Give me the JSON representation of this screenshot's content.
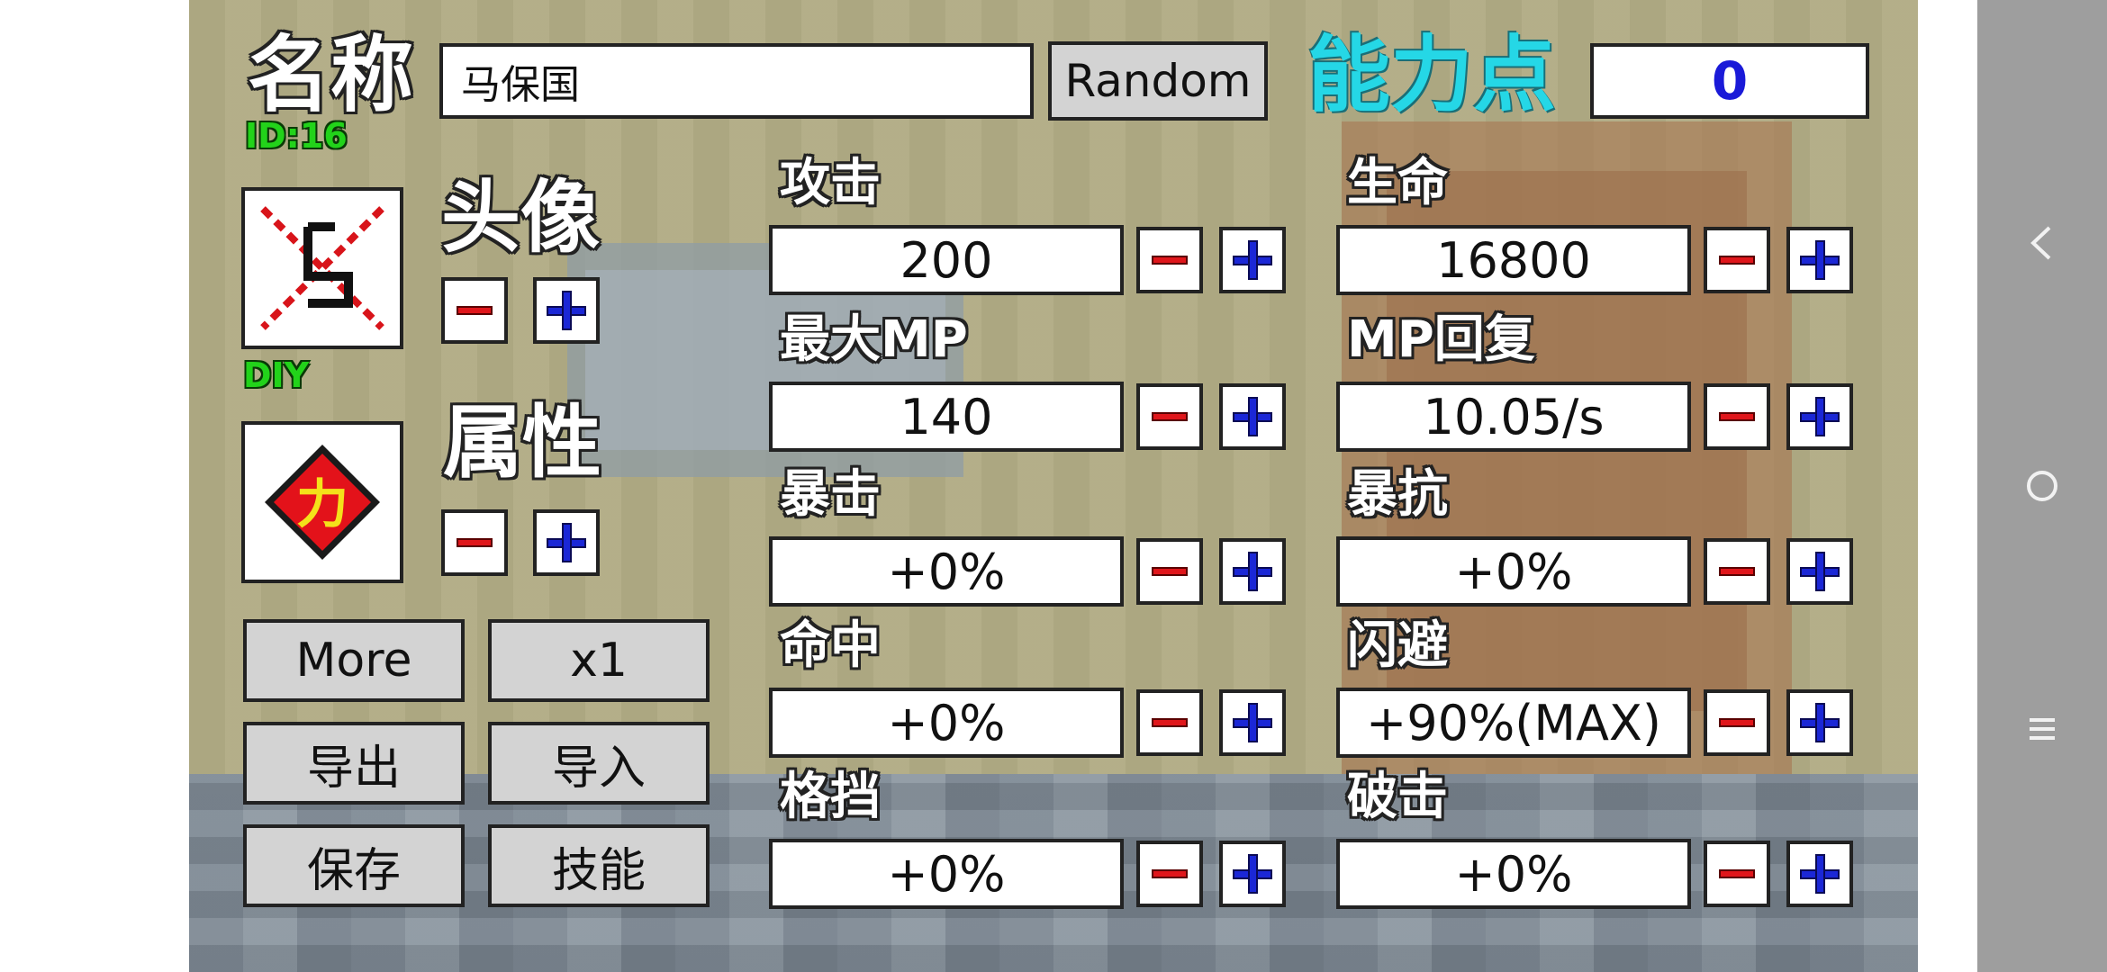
{
  "header": {
    "name_label": "名称",
    "name_value": "马保国",
    "random_label": "Random",
    "points_label": "能力点",
    "points_value": "0",
    "id_text": "ID:16"
  },
  "avatar": {
    "label": "头像",
    "tag": "DIY"
  },
  "attribute": {
    "label": "属性",
    "glyph": "力"
  },
  "buttons": {
    "more": "More",
    "multiplier": "x1",
    "export": "导出",
    "import": "导入",
    "save": "保存",
    "skills": "技能"
  },
  "stats": [
    {
      "label": "攻击",
      "value": "200"
    },
    {
      "label": "生命",
      "value": "16800"
    },
    {
      "label": "最大MP",
      "value": "140"
    },
    {
      "label": "MP回复",
      "value": "10.05/s"
    },
    {
      "label": "暴击",
      "value": "+0%"
    },
    {
      "label": "暴抗",
      "value": "+0%"
    },
    {
      "label": "命中",
      "value": "+0%"
    },
    {
      "label": "闪避",
      "value": "+90%(MAX)"
    },
    {
      "label": "格挡",
      "value": "+0%"
    },
    {
      "label": "破击",
      "value": "+0%"
    }
  ],
  "icons": {
    "minus": "minus-icon",
    "plus": "plus-icon",
    "back": "back-icon",
    "home": "home-icon",
    "menu": "menu-icon"
  },
  "colors": {
    "points_text": "#1a1ad8",
    "points_title": "#25d7e6",
    "id_green": "#22d31a",
    "minus_red": "#e0161b",
    "plus_blue": "#1b27d6"
  }
}
